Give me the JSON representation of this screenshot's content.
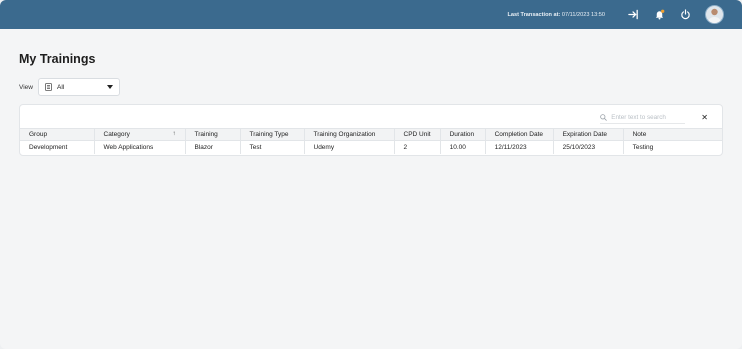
{
  "topbar": {
    "last_transaction_label": "Last Transaction at:",
    "last_transaction_value": "07/11/2023 13:50"
  },
  "page": {
    "title": "My Trainings"
  },
  "view": {
    "label": "View",
    "selected": "All"
  },
  "search": {
    "placeholder": "Enter text to search",
    "clear": "✕"
  },
  "table": {
    "sort_indicator": "↑",
    "columns": [
      "Group",
      "Category",
      "Training",
      "Training Type",
      "Training Organization",
      "CPD Unit",
      "Duration",
      "Completion Date",
      "Expiration Date",
      "Note"
    ],
    "rows": [
      [
        "Development",
        "Web Applications",
        "Blazor",
        "Test",
        "Udemy",
        "2",
        "10.00",
        "12/11/2023",
        "25/10/2023",
        "Testing"
      ]
    ]
  },
  "colors": {
    "topbar": "#3b6a8e",
    "notification_dot": "#f0a030"
  }
}
